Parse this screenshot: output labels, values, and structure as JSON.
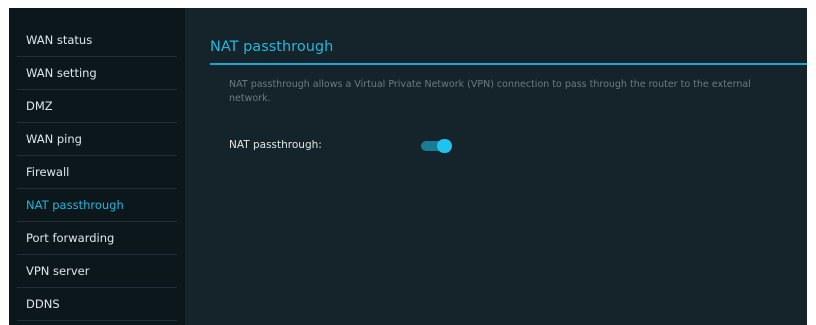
{
  "sidebar": {
    "items": [
      {
        "label": "WAN status"
      },
      {
        "label": "WAN setting"
      },
      {
        "label": "DMZ"
      },
      {
        "label": "WAN ping"
      },
      {
        "label": "Firewall"
      },
      {
        "label": "NAT passthrough"
      },
      {
        "label": "Port forwarding"
      },
      {
        "label": "VPN server"
      },
      {
        "label": "DDNS"
      }
    ],
    "active": "NAT passthrough"
  },
  "main": {
    "title": "NAT passthrough",
    "description": "NAT passthrough allows a Virtual Private Network (VPN) connection to pass through the router to the external network.",
    "setting": {
      "label": "NAT passthrough:",
      "enabled": true
    }
  },
  "colors": {
    "accent": "#1fb6dc",
    "toggle_on": "#1cc4ee",
    "panel_bg": "#15232a",
    "sidebar_bg": "#0c171c"
  }
}
